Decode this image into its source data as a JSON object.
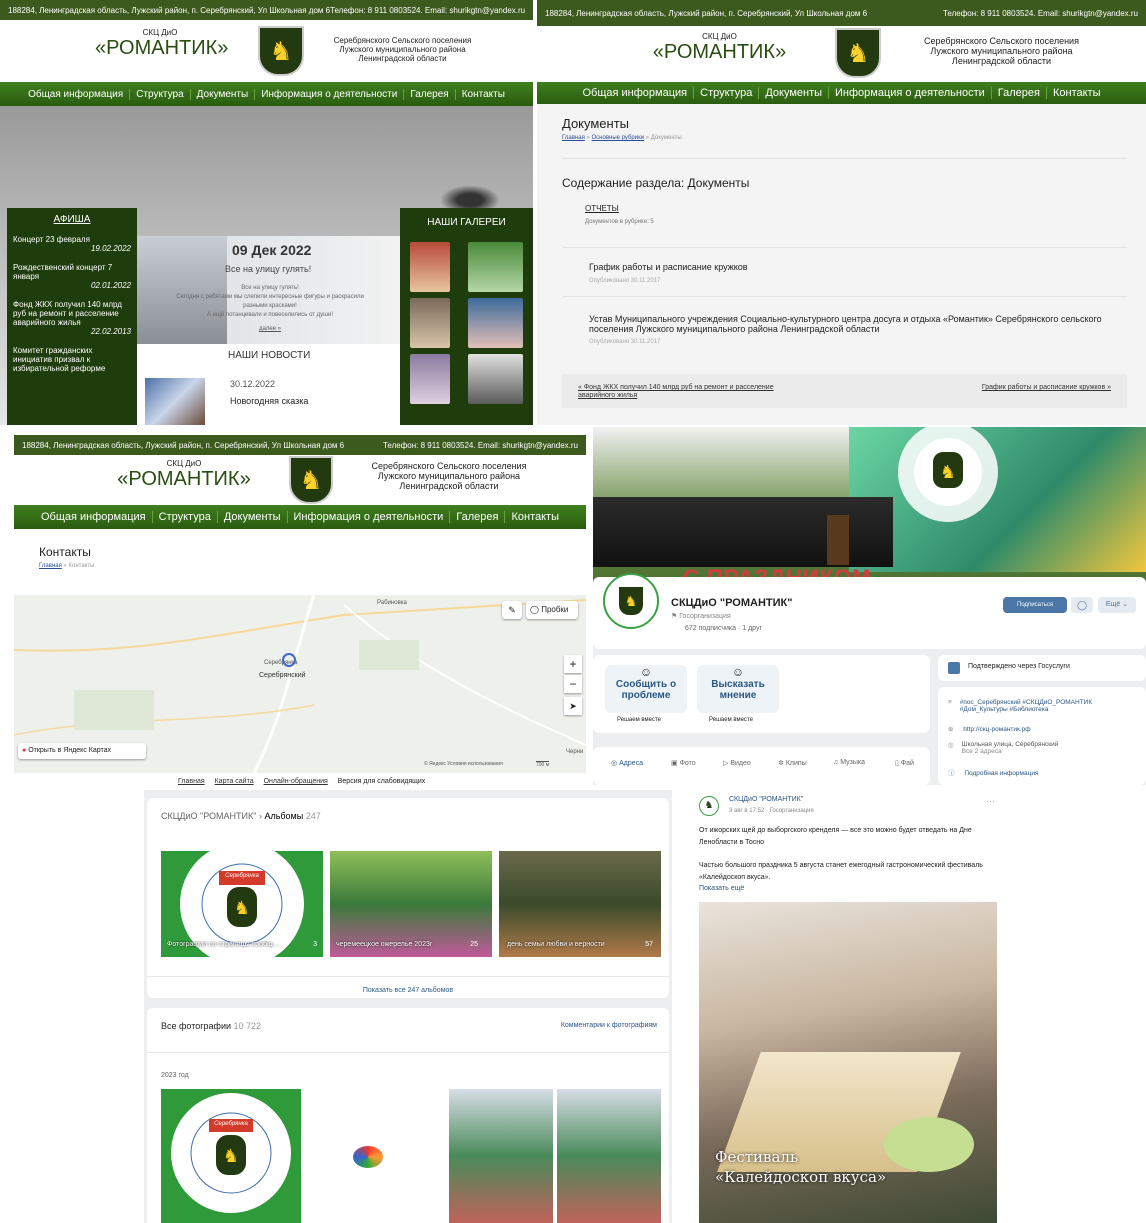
{
  "site": {
    "address": "188284, Ленинградская область, Лужский район, п. Серебрянский, Ул Школьная дом 6",
    "contacts": "Телефон: 8 911 0803524. Email: shurikgtn@yandex.ru",
    "org_abbr": "СКЦ ДиО",
    "org_name": "«РОМАНТИК»",
    "region_1": "Серебрянского Сельского поселения",
    "region_2": "Лужского муниципального района",
    "region_3": "Ленинградской области",
    "nav": [
      "Общая информация",
      "Структура",
      "Документы",
      "Информация о деятельности",
      "Галерея",
      "Контакты"
    ]
  },
  "home": {
    "afisha_title": "АФИША",
    "afisha": [
      {
        "title": "Концерт 23 февраля",
        "date": "19.02.2022"
      },
      {
        "title": "Рождественский концерт 7 января",
        "date": "02.01.2022"
      },
      {
        "title": "Фонд ЖКХ получил 140 млрд руб на ремонт и расселение аварийного жилья",
        "date": "22.02.2013"
      },
      {
        "title": "Комитет гражданских инициатив призвал к избирательной реформе",
        "date": ""
      }
    ],
    "slide_date": "09 Дек 2022",
    "slide_title": "Все на улицу гулять!",
    "slide_text_1": "Все на улицу гулять!",
    "slide_text_2": "Сегодня с ребятами мы слепили интересные фигуры и раскрасили разными красками!",
    "slide_text_3": "А ещё потанцевали и повеселились от души!",
    "slide_more": "далее »",
    "news_title": "НАШИ НОВОСТИ",
    "news_date": "30.12.2022",
    "news_item": "Новогодняя сказка",
    "gallery_title": "НАШИ ГАЛЕРЕИ"
  },
  "docs": {
    "title": "Документы",
    "crumb_home": "Главная",
    "crumb_sep1": " » ",
    "crumb_rubrics": "Основные рубрики",
    "crumb_sep2": " » Документы",
    "section": "Содержание раздела: Документы",
    "sub_link": "ОТЧЕТЫ",
    "sub_count": "Документов в рубрике: 5",
    "item1": "График работы и расписание кружков",
    "item1_pub": "Опубликовано 30.11.2017",
    "item2": "Устав Муниципального учреждения Социально-культурного центра досуга и отдыха «Романтик» Серебрянского сельского поселения Лужского муниципального района Ленинградской области",
    "item2_pub": "Опубликовано 30.11.2017",
    "prev": "« Фонд ЖКХ получил 140 млрд руб на ремонт и расселение аварийного жилья",
    "next": "График работы и расписание кружков »"
  },
  "contacts": {
    "title": "Контакты",
    "crumb_home": "Главная",
    "crumb_rest": " » Контакты",
    "traffic": "Пробки",
    "open_maps": "Открыть в Яндекс Картах",
    "map_place_1": "Рабиновка",
    "map_place_2": "Серебрянка",
    "map_place_3": "Серебрянский",
    "map_copy": "© Яндекс  Условия использования",
    "map_scale": "700 м",
    "map_edge": "Черни",
    "footer": [
      "Главная",
      "Карта сайта",
      "Онлайн-обращения",
      "Версия для слабовидящих"
    ]
  },
  "vk": {
    "banner": "С ПРАЗДНИКОМ",
    "seal_text": "СЕРЕБРЯНСКОЕ СЕЛЬСКОЕ ПОСЕЛЕНИЕ ЛУЖСКИЙ РАЙОН",
    "name": "СКЦДиО \"РОМАНТИК\"",
    "type": "Госорганизация",
    "subs": "672 подписчика · 1 друг",
    "subscribe": "Подписаться",
    "more": "Ещё",
    "btn1": "Сообщить о проблеме",
    "btn1_sub": "Решаем вместе",
    "btn2": "Высказать мнение",
    "btn2_sub": "Решаем вместе",
    "verified": "Подтверждено через Госуслуги",
    "tags": "#пос_Серебрянский #СКЦДиО_РОМАНТИК #Дом_Культуры #Библиотека",
    "site": "http://скц-романтик.рф",
    "addr": "Школьная улица, Серебрянский",
    "addr_sub": "Все 2 адреса",
    "details": "Подробная информация",
    "tabs": [
      "Адреса",
      "Фото",
      "Видео",
      "Клипы",
      "Музыка",
      "Фай"
    ]
  },
  "albums": {
    "crumb": "СКЦДиО \"РОМАНТИК\"",
    "title": "Альбомы",
    "count": "247",
    "items": [
      {
        "name": "Фотографии со страницы сообщ…",
        "count": "3"
      },
      {
        "name": "черемеецкое ожерелье 2023г",
        "count": "25"
      },
      {
        "name": "день семьи любви и верности",
        "count": "57"
      }
    ],
    "show_all": "Показать все 247 альбомов",
    "all_photos": "Все фотографии",
    "all_count": "10 722",
    "comments": "Комментарии к фотографиям",
    "year": "2023 год",
    "logo_text": "Серебрянка",
    "seal_text": "СЕРЕБРЯНСКОЕ СЕЛЬСКОЕ ПОСЕЛЕНИЕ ЛУЖСКИЙ РАЙОН"
  },
  "post": {
    "author": "СКЦДиО \"РОМАНТИК\"",
    "meta": "3 авг в 17:52 · Госорганизация",
    "text1": "От ижорских щей до выборгского кренделя — все это можно будет отведать на Дне Ленобласти в Тосно",
    "text2": "Частью большого праздника 5 августа станет ежегодный гастрономический фестиваль «Калейдоскоп вкуса».",
    "more": "Показать ещё",
    "caption1": "Фестиваль",
    "caption2": "«Калейдоскоп вкуса»"
  },
  "colors": {
    "brand_green": "#2a5c10",
    "dark_green": "#1f3c0d",
    "vk_blue": "#4a76a8"
  }
}
